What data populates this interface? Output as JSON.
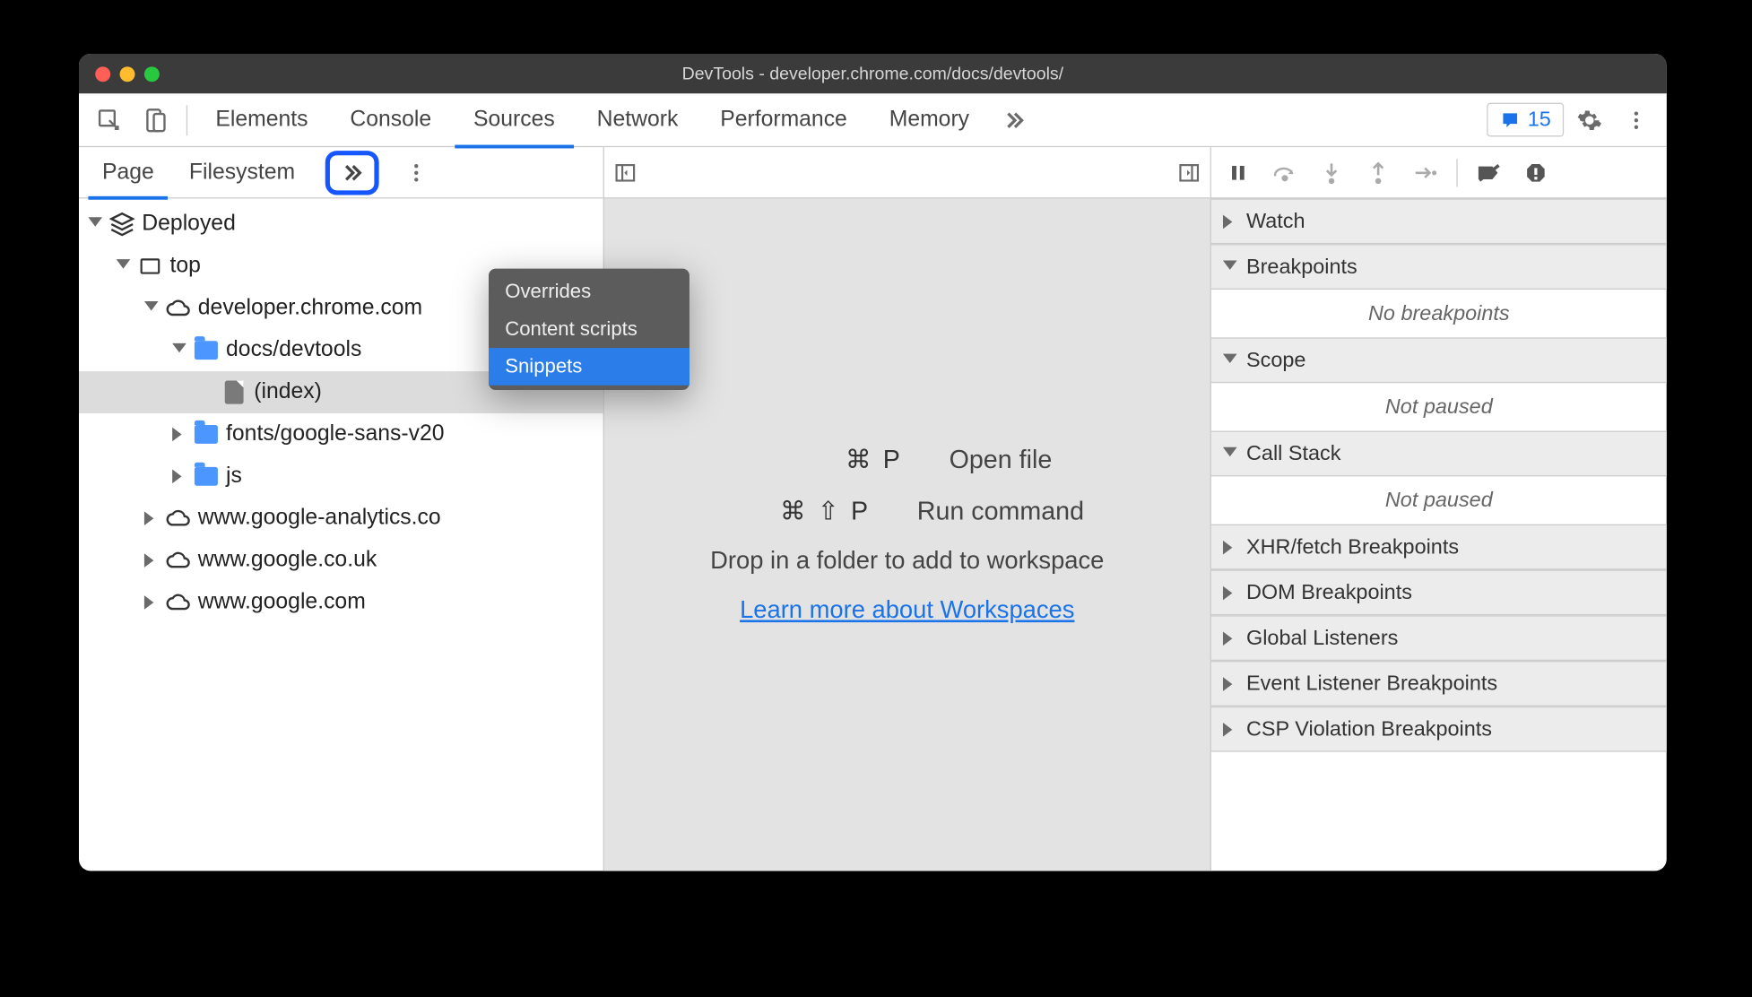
{
  "window": {
    "title": "DevTools - developer.chrome.com/docs/devtools/"
  },
  "toolbar": {
    "tabs": [
      "Elements",
      "Console",
      "Sources",
      "Network",
      "Performance",
      "Memory"
    ],
    "active_tab": "Sources",
    "issues_count": "15"
  },
  "sidebar": {
    "tabs": [
      "Page",
      "Filesystem"
    ],
    "active_tab": "Page",
    "popup": {
      "items": [
        "Overrides",
        "Content scripts",
        "Snippets"
      ],
      "selected": "Snippets"
    },
    "tree": {
      "deployed": "Deployed",
      "top": "top",
      "origin_main": "developer.chrome.com",
      "folder_docs": "docs/devtools",
      "file_index": "(index)",
      "folder_fonts": "fonts/google-sans-v20",
      "folder_js": "js",
      "origin_ga": "www.google-analytics.co",
      "origin_guk": "www.google.co.uk",
      "origin_gcom": "www.google.com"
    }
  },
  "editor": {
    "shortcuts": [
      {
        "keys": "⌘ P",
        "label": "Open file"
      },
      {
        "keys": "⌘ ⇧ P",
        "label": "Run command"
      }
    ],
    "hint": "Drop in a folder to add to workspace",
    "link": "Learn more about Workspaces"
  },
  "debugger": {
    "sections": [
      {
        "label": "Watch",
        "open": false,
        "body": null
      },
      {
        "label": "Breakpoints",
        "open": true,
        "body": "No breakpoints"
      },
      {
        "label": "Scope",
        "open": true,
        "body": "Not paused"
      },
      {
        "label": "Call Stack",
        "open": true,
        "body": "Not paused"
      },
      {
        "label": "XHR/fetch Breakpoints",
        "open": false,
        "body": null
      },
      {
        "label": "DOM Breakpoints",
        "open": false,
        "body": null
      },
      {
        "label": "Global Listeners",
        "open": false,
        "body": null
      },
      {
        "label": "Event Listener Breakpoints",
        "open": false,
        "body": null
      },
      {
        "label": "CSP Violation Breakpoints",
        "open": false,
        "body": null
      }
    ]
  }
}
